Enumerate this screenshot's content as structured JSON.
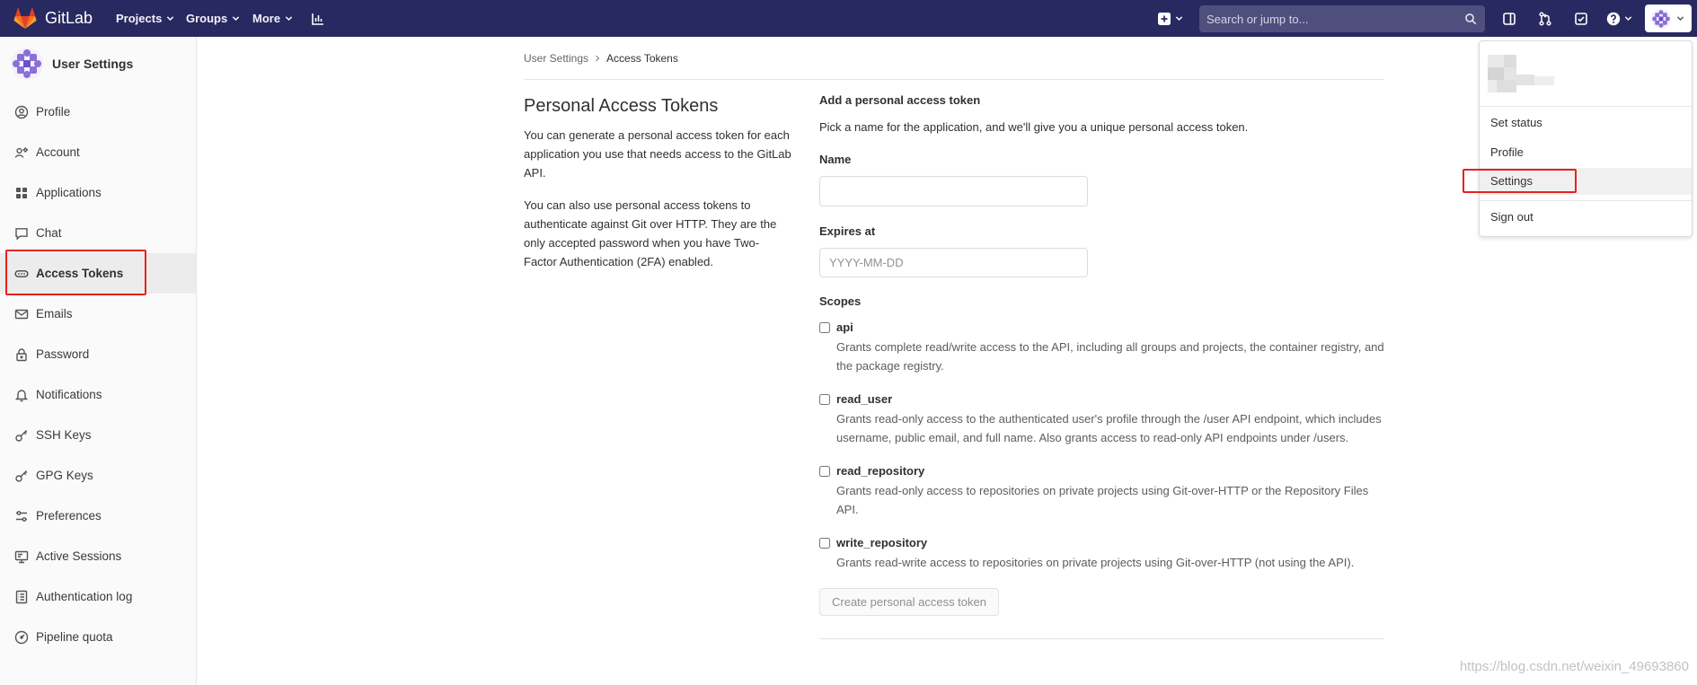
{
  "colors": {
    "navbar_bg": "#292961",
    "sidebar_bg": "#fafafa",
    "active_item_bg": "#ececec",
    "annotation_border": "#e8211f"
  },
  "navbar": {
    "brand": "GitLab",
    "menu": [
      {
        "label": "Projects",
        "icon": "chevron-down-icon"
      },
      {
        "label": "Groups",
        "icon": "chevron-down-icon"
      },
      {
        "label": "More",
        "icon": "chevron-down-icon"
      }
    ],
    "search": {
      "placeholder": "Search or jump to...",
      "value": ""
    },
    "right_icons": [
      "plus-square-icon",
      "issues-icon",
      "merge-request-icon",
      "todo-icon",
      "help-icon",
      "user-avatar"
    ]
  },
  "sidebar": {
    "title": "User Settings",
    "items": [
      {
        "label": "Profile",
        "icon": "profile-icon"
      },
      {
        "label": "Account",
        "icon": "account-icon"
      },
      {
        "label": "Applications",
        "icon": "applications-icon"
      },
      {
        "label": "Chat",
        "icon": "chat-icon"
      },
      {
        "label": "Access Tokens",
        "icon": "token-icon",
        "active": true
      },
      {
        "label": "Emails",
        "icon": "mail-icon"
      },
      {
        "label": "Password",
        "icon": "lock-icon"
      },
      {
        "label": "Notifications",
        "icon": "bell-icon"
      },
      {
        "label": "SSH Keys",
        "icon": "key-icon"
      },
      {
        "label": "GPG Keys",
        "icon": "key-icon"
      },
      {
        "label": "Preferences",
        "icon": "preferences-icon"
      },
      {
        "label": "Active Sessions",
        "icon": "monitor-icon"
      },
      {
        "label": "Authentication log",
        "icon": "log-icon"
      },
      {
        "label": "Pipeline quota",
        "icon": "gauge-icon"
      }
    ]
  },
  "breadcrumb": {
    "items": [
      "User Settings",
      "Access Tokens"
    ]
  },
  "intro": {
    "title": "Personal Access Tokens",
    "paragraphs": [
      "You can generate a personal access token for each application you use that needs access to the GitLab API.",
      "You can also use personal access tokens to authenticate against Git over HTTP. They are the only accepted password when you have Two-Factor Authentication (2FA) enabled."
    ]
  },
  "form": {
    "heading": "Add a personal access token",
    "description": "Pick a name for the application, and we'll give you a unique personal access token.",
    "name": {
      "label": "Name",
      "value": ""
    },
    "expires": {
      "label": "Expires at",
      "value": "",
      "placeholder": "YYYY-MM-DD"
    },
    "scopes_label": "Scopes",
    "scopes": [
      {
        "name": "api",
        "checked": false,
        "description": "Grants complete read/write access to the API, including all groups and projects, the container registry, and the package registry."
      },
      {
        "name": "read_user",
        "checked": false,
        "description": "Grants read-only access to the authenticated user's profile through the /user API endpoint, which includes username, public email, and full name. Also grants access to read-only API endpoints under /users."
      },
      {
        "name": "read_repository",
        "checked": false,
        "description": "Grants read-only access to repositories on private projects using Git-over-HTTP or the Repository Files API."
      },
      {
        "name": "write_repository",
        "checked": false,
        "description": "Grants read-write access to repositories on private projects using Git-over-HTTP (not using the API)."
      }
    ],
    "submit_label": "Create personal access token"
  },
  "user_menu": {
    "items": [
      {
        "label": "Set status"
      },
      {
        "label": "Profile"
      },
      {
        "label": "Settings",
        "highlighted": true
      },
      {
        "label": "Sign out"
      }
    ]
  },
  "watermark": "https://blog.csdn.net/weixin_49693860"
}
